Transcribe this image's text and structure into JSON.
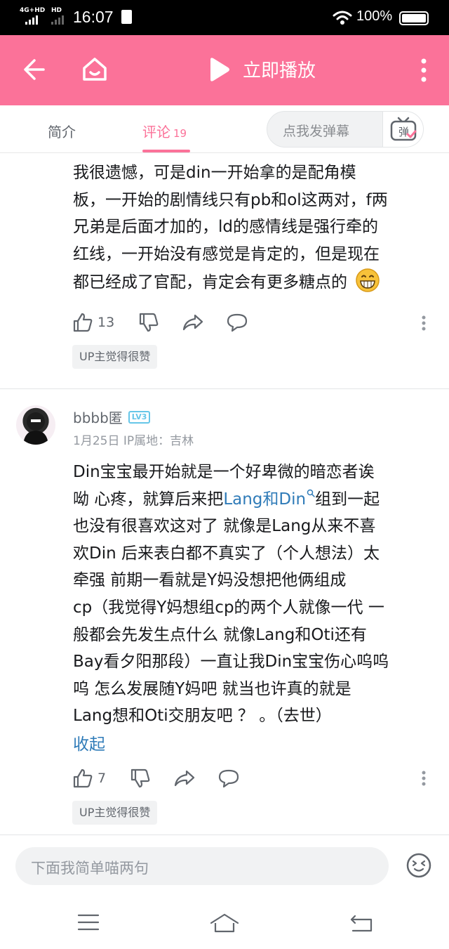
{
  "status_bar": {
    "network": "4G+HD",
    "network2": "HD",
    "time": "16:07",
    "battery": "100%"
  },
  "top_bar": {
    "play_label": "立即播放"
  },
  "tabs": {
    "intro": "简介",
    "comments": "评论",
    "comments_count": "19",
    "danmaku_placeholder": "点我发弹幕",
    "danmaku_icon_text": "弹"
  },
  "comment1": {
    "lines": [
      "我很遗憾，可是din一开始拿的是配角模",
      "板，一开始的剧情线只有pb和ol这两对，f两",
      "兄弟是后面才加的，ld的感情线是强行牵的",
      "红线，一开始没有感觉是肯定的，但是现在",
      "都已经成了官配，肯定会有更多糖点的"
    ],
    "likes": "13",
    "badge": "UP主觉得很赞"
  },
  "comment2": {
    "username": "bbbb匿",
    "level": "LV3",
    "meta": "1月25日  IP属地：吉林",
    "line1": "Din宝宝最开始就是一个好卑微的暗恋者诶",
    "line2_pre": "呦 心疼，就算后来把",
    "line2_link": "Lang和Din",
    "line2_post": "组到一起",
    "lines_rest": [
      "也没有很喜欢这对了 就像是Lang从来不喜",
      "欢Din 后来表白都不真实了（个人想法）太",
      "牵强 前期一看就是Y妈没想把他俩组成",
      "cp（我觉得Y妈想组cp的两个人就像一代 一",
      "般都会先发生点什么 就像Lang和Oti还有",
      "Bay看夕阳那段）一直让我Din宝宝伤心呜呜",
      "呜 怎么发展随Y妈吧  就当也许真的就是",
      "Lang想和Oti交朋友吧 ？ 。（去世）"
    ],
    "collapse": "收起",
    "likes": "7",
    "badge": "UP主觉得很赞"
  },
  "input_bar": {
    "placeholder": "下面我简单喵两句"
  },
  "colors": {
    "brand_pink": "#fb7299",
    "link_blue": "#2f7bb8"
  }
}
